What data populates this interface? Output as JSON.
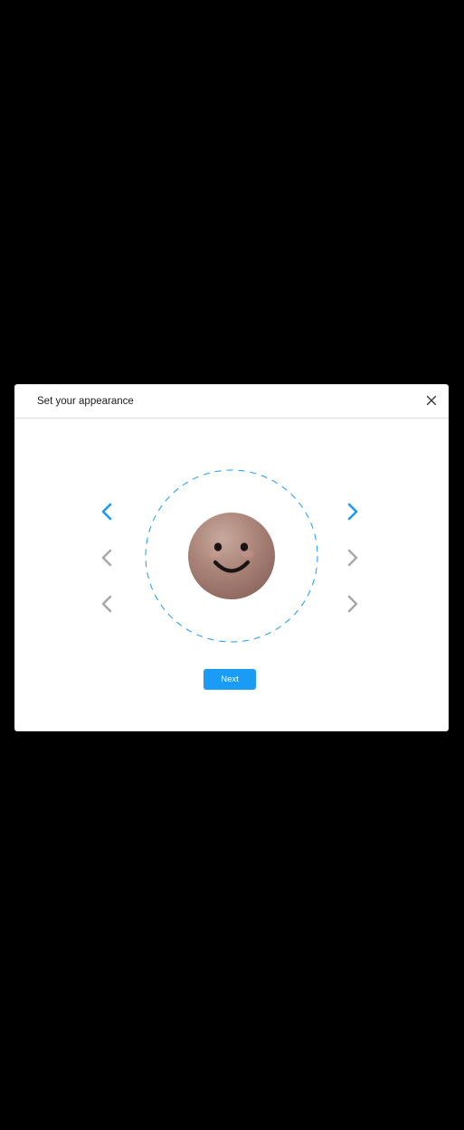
{
  "dialog": {
    "title": "Set your appearance",
    "close_icon": "close-icon",
    "next_label": "Next"
  },
  "selectors": [
    {
      "row": "row-1",
      "active": true,
      "prev_icon": "chevron-left-icon",
      "next_icon": "chevron-right-icon"
    },
    {
      "row": "row-2",
      "active": false,
      "prev_icon": "chevron-left-icon",
      "next_icon": "chevron-right-icon"
    },
    {
      "row": "row-3",
      "active": false,
      "prev_icon": "chevron-left-icon",
      "next_icon": "chevron-right-icon"
    }
  ],
  "avatar": {
    "icon": "smiley-face-icon",
    "skin_color": "#a88176"
  },
  "colors": {
    "accent": "#1a9bf5",
    "inactive_arrow": "#a9a9a9",
    "backdrop": "#000000",
    "dialog_bg": "#ffffff"
  }
}
